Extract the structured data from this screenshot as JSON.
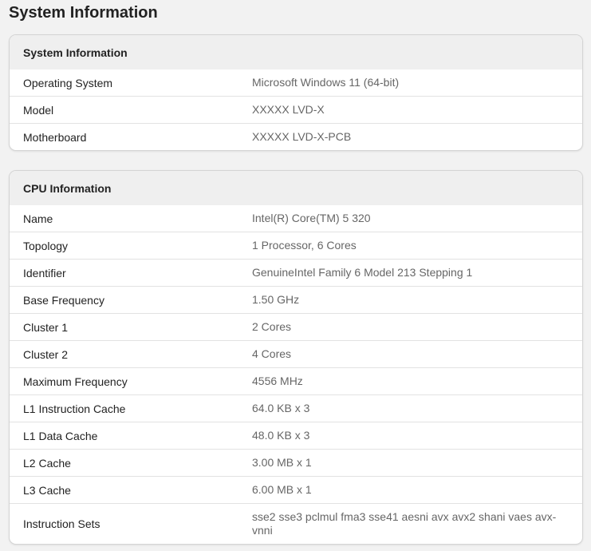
{
  "page_title": "System Information",
  "system": {
    "title": "System Information",
    "rows": [
      {
        "label": "Operating System",
        "value": "Microsoft Windows 11 (64-bit)"
      },
      {
        "label": "Model",
        "value": "XXXXX LVD-X"
      },
      {
        "label": "Motherboard",
        "value": "XXXXX LVD-X-PCB"
      }
    ]
  },
  "cpu": {
    "title": "CPU Information",
    "rows": [
      {
        "label": "Name",
        "value": "Intel(R) Core(TM) 5 320"
      },
      {
        "label": "Topology",
        "value": "1 Processor, 6 Cores"
      },
      {
        "label": "Identifier",
        "value": "GenuineIntel Family 6 Model 213 Stepping 1"
      },
      {
        "label": "Base Frequency",
        "value": "1.50 GHz"
      },
      {
        "label": "Cluster 1",
        "value": "2 Cores"
      },
      {
        "label": "Cluster 2",
        "value": "4 Cores"
      },
      {
        "label": "Maximum Frequency",
        "value": "4556 MHz"
      },
      {
        "label": "L1 Instruction Cache",
        "value": "64.0 KB x 3"
      },
      {
        "label": "L1 Data Cache",
        "value": "48.0 KB x 3"
      },
      {
        "label": "L2 Cache",
        "value": "3.00 MB x 1"
      },
      {
        "label": "L3 Cache",
        "value": "6.00 MB x 1"
      },
      {
        "label": "Instruction Sets",
        "value": "sse2 sse3 pclmul fma3 sse41 aesni avx avx2 shani vaes avx-vnni"
      }
    ]
  }
}
